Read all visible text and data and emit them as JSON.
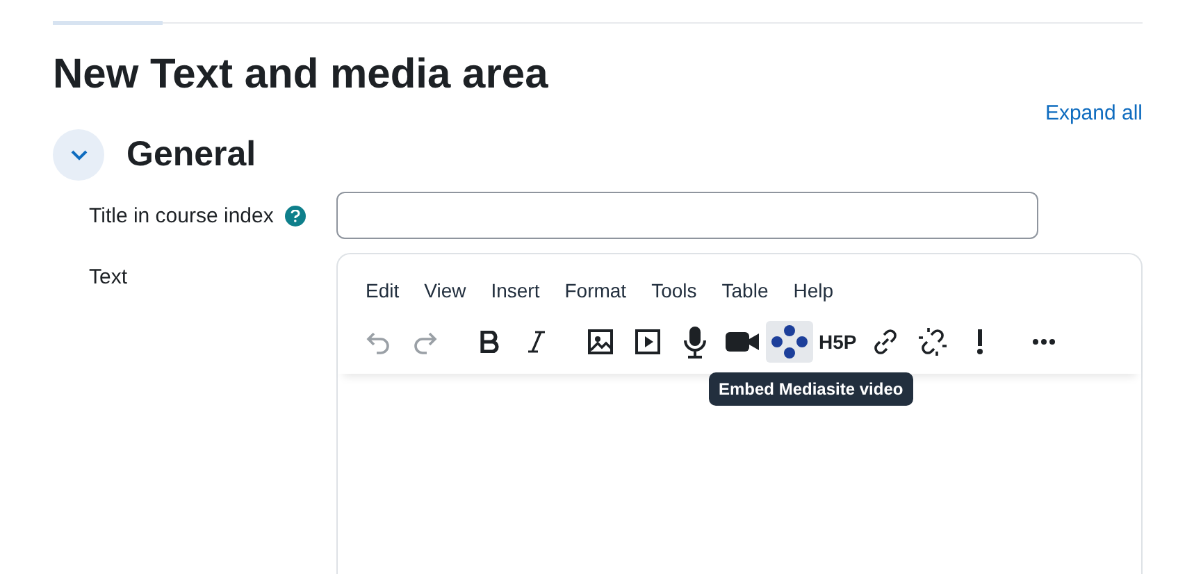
{
  "page_title": "New Text and media area",
  "expand_all": "Expand all",
  "section": {
    "title": "General",
    "expanded": true
  },
  "fields": [
    {
      "kind": "text",
      "label": "Title in course index",
      "help": true
    },
    {
      "kind": "editor",
      "label": "Text"
    }
  ],
  "editor": {
    "menu": [
      "Edit",
      "View",
      "Insert",
      "Format",
      "Tools",
      "Table",
      "Help"
    ],
    "toolbar": [
      {
        "kind": "undo",
        "disabled": true,
        "hovered": false
      },
      {
        "kind": "redo",
        "disabled": true,
        "hovered": false
      },
      {
        "kind": "bold",
        "disabled": false,
        "hovered": false
      },
      {
        "kind": "italic",
        "disabled": false,
        "hovered": false
      },
      {
        "kind": "image",
        "disabled": false,
        "hovered": false
      },
      {
        "kind": "media",
        "disabled": false,
        "hovered": false
      },
      {
        "kind": "mic",
        "disabled": false,
        "hovered": false
      },
      {
        "kind": "camera",
        "disabled": false,
        "hovered": false
      },
      {
        "kind": "mediasite",
        "disabled": false,
        "hovered": true
      },
      {
        "kind": "h5p",
        "disabled": false,
        "hovered": false,
        "text": "H5P"
      },
      {
        "kind": "link",
        "disabled": false,
        "hovered": false
      },
      {
        "kind": "unlink",
        "disabled": false,
        "hovered": false
      },
      {
        "kind": "accessibility",
        "disabled": false,
        "hovered": false
      },
      {
        "kind": "more",
        "disabled": false,
        "hovered": false
      }
    ],
    "tooltip": "Embed Mediasite video"
  }
}
